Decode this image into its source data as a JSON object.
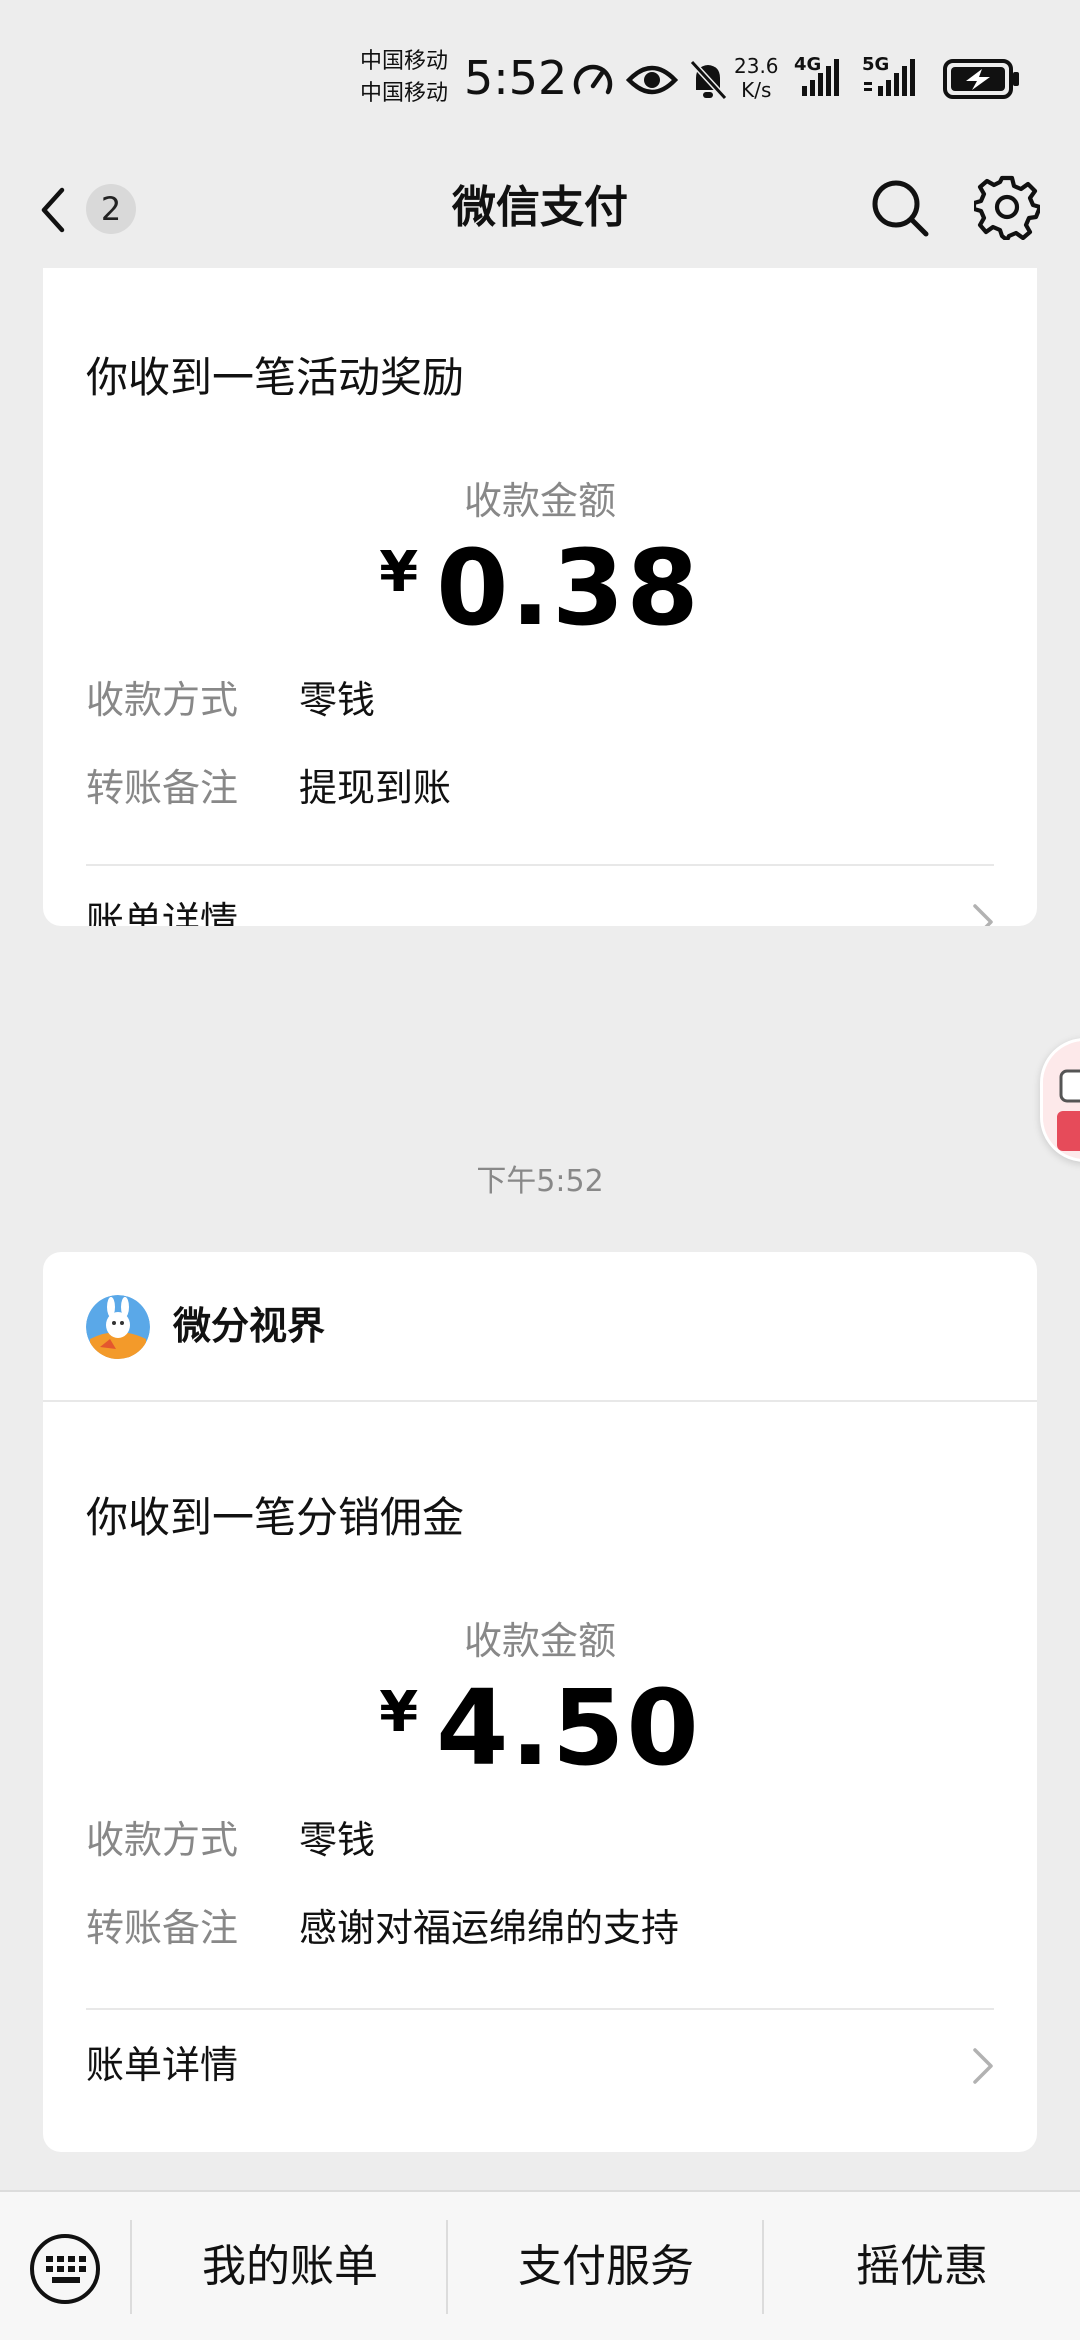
{
  "status_bar": {
    "carrier_1": "中国移动",
    "carrier_2": "中国移动",
    "time": "5:52",
    "net_speed_value": "23.6",
    "net_speed_unit": "K/s",
    "sim1_type": "4G",
    "sim2_type": "5G",
    "icons": [
      "speedometer-icon",
      "eye-icon",
      "bell-off-icon",
      "signal-icon",
      "signal-icon",
      "battery-charging-icon"
    ]
  },
  "nav": {
    "back_badge": "2",
    "title": "微信支付",
    "icons": [
      "back-chevron-icon",
      "search-icon",
      "gear-icon"
    ]
  },
  "cards": [
    {
      "source": "",
      "heading": "你收到一笔活动奖励",
      "amount_label": "收款金额",
      "currency": "¥",
      "amount": "0.38",
      "method_label": "收款方式",
      "method_value": "零钱",
      "note_label": "转账备注",
      "note_value": "提现到账",
      "detail_label": "账单详情"
    },
    {
      "source": "微分视界",
      "heading": "你收到一笔分销佣金",
      "amount_label": "收款金额",
      "currency": "¥",
      "amount": "4.50",
      "method_label": "收款方式",
      "method_value": "零钱",
      "note_label": "转账备注",
      "note_value": "感谢对福运绵绵的支持",
      "detail_label": "账单详情"
    }
  ],
  "timestamp": "下午5:52",
  "bottom_bar": {
    "keyboard_icon": "keyboard-icon",
    "items": [
      "我的账单",
      "支付服务",
      "摇优惠"
    ]
  },
  "colors": {
    "background": "#ededed",
    "card": "#ffffff",
    "secondary_text": "#888888",
    "primary_text": "#111111"
  }
}
